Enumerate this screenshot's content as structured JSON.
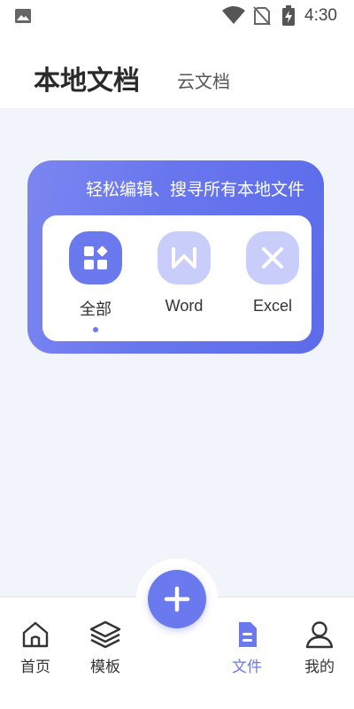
{
  "status_bar": {
    "time": "4:30"
  },
  "header": {
    "tab_local": "本地文档",
    "tab_cloud": "云文档"
  },
  "card": {
    "tip": "轻松编辑、搜寻所有本地文件",
    "categories": [
      {
        "label": "全部",
        "icon": "grid-icon"
      },
      {
        "label": "Word",
        "icon": "word-icon"
      },
      {
        "label": "Excel",
        "icon": "excel-icon"
      }
    ]
  },
  "fab": {
    "icon": "plus-icon"
  },
  "bottom_nav": [
    {
      "label": "首页",
      "icon": "home-icon"
    },
    {
      "label": "模板",
      "icon": "layers-icon"
    },
    {
      "label": "文件",
      "icon": "file-icon"
    },
    {
      "label": "我的",
      "icon": "person-icon"
    }
  ],
  "colors": {
    "accent": "#6b79ee",
    "accent_light": "#c8cdf9",
    "background": "#f1f4fa"
  }
}
